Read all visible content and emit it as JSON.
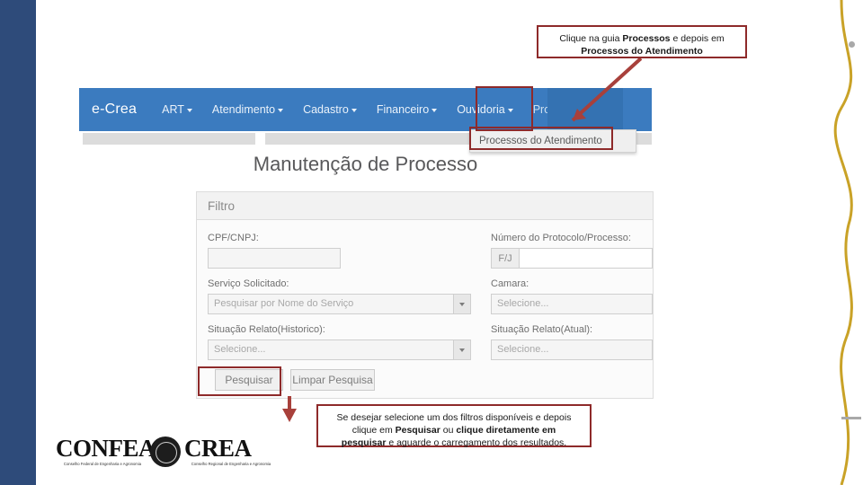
{
  "slide": {
    "accent_navy": "#2e4b7a",
    "accent_gold": "#c9a227",
    "highlight_red": "#8e2a2a"
  },
  "screenshot": {
    "navbar": {
      "brand": "e-Crea",
      "items": [
        {
          "label": "ART",
          "has_caret": true,
          "active": false
        },
        {
          "label": "Atendimento",
          "has_caret": true,
          "active": false
        },
        {
          "label": "Cadastro",
          "has_caret": true,
          "active": false
        },
        {
          "label": "Financeiro",
          "has_caret": true,
          "active": false
        },
        {
          "label": "Ouvidoria",
          "has_caret": true,
          "active": false
        },
        {
          "label": "Processo",
          "has_caret": true,
          "active": true
        }
      ],
      "dropdown_item": "Processos do Atendimento"
    },
    "page_title": "Manutenção de Processo",
    "filter_panel": {
      "header": "Filtro",
      "fields": {
        "cpf_cnpj_label": "CPF/CNPJ:",
        "cpf_cnpj_value": "",
        "protocolo_label": "Número do Protocolo/Processo:",
        "protocolo_prefix": "F/J",
        "protocolo_value": "",
        "servico_label": "Serviço Solicitado:",
        "servico_placeholder": "Pesquisar por Nome do Serviço",
        "camara_label": "Camara:",
        "camara_placeholder": "Selecione...",
        "situacao_hist_label": "Situação Relato(Historico):",
        "situacao_hist_placeholder": "Selecione...",
        "situacao_atual_label": "Situação Relato(Atual):",
        "situacao_atual_placeholder": "Selecione..."
      },
      "buttons": {
        "search": "Pesquisar",
        "clear": "Limpar Pesquisa"
      }
    }
  },
  "callouts": {
    "top": {
      "part1": "Clique na guia ",
      "bold1": "Processos",
      "part2": " e depois em",
      "bold2": "Processos do Atendimento"
    },
    "bottom": {
      "line1": "Se desejar selecione um dos filtros disponíveis e depois",
      "line2_a": "clique em ",
      "line2_b": "Pesquisar",
      "line2_c": " ou ",
      "line2_d": "clique diretamente em",
      "line3_a": "pesquisar",
      "line3_b": " e aguarde o carregamento dos resultados."
    }
  },
  "footer": {
    "confea": "CONFEA",
    "crea": "CREA",
    "confea_sub": "Conselho Federal de Engenharia e Agronomia",
    "crea_sub": "Conselho Regional de Engenharia e Agronomia"
  }
}
